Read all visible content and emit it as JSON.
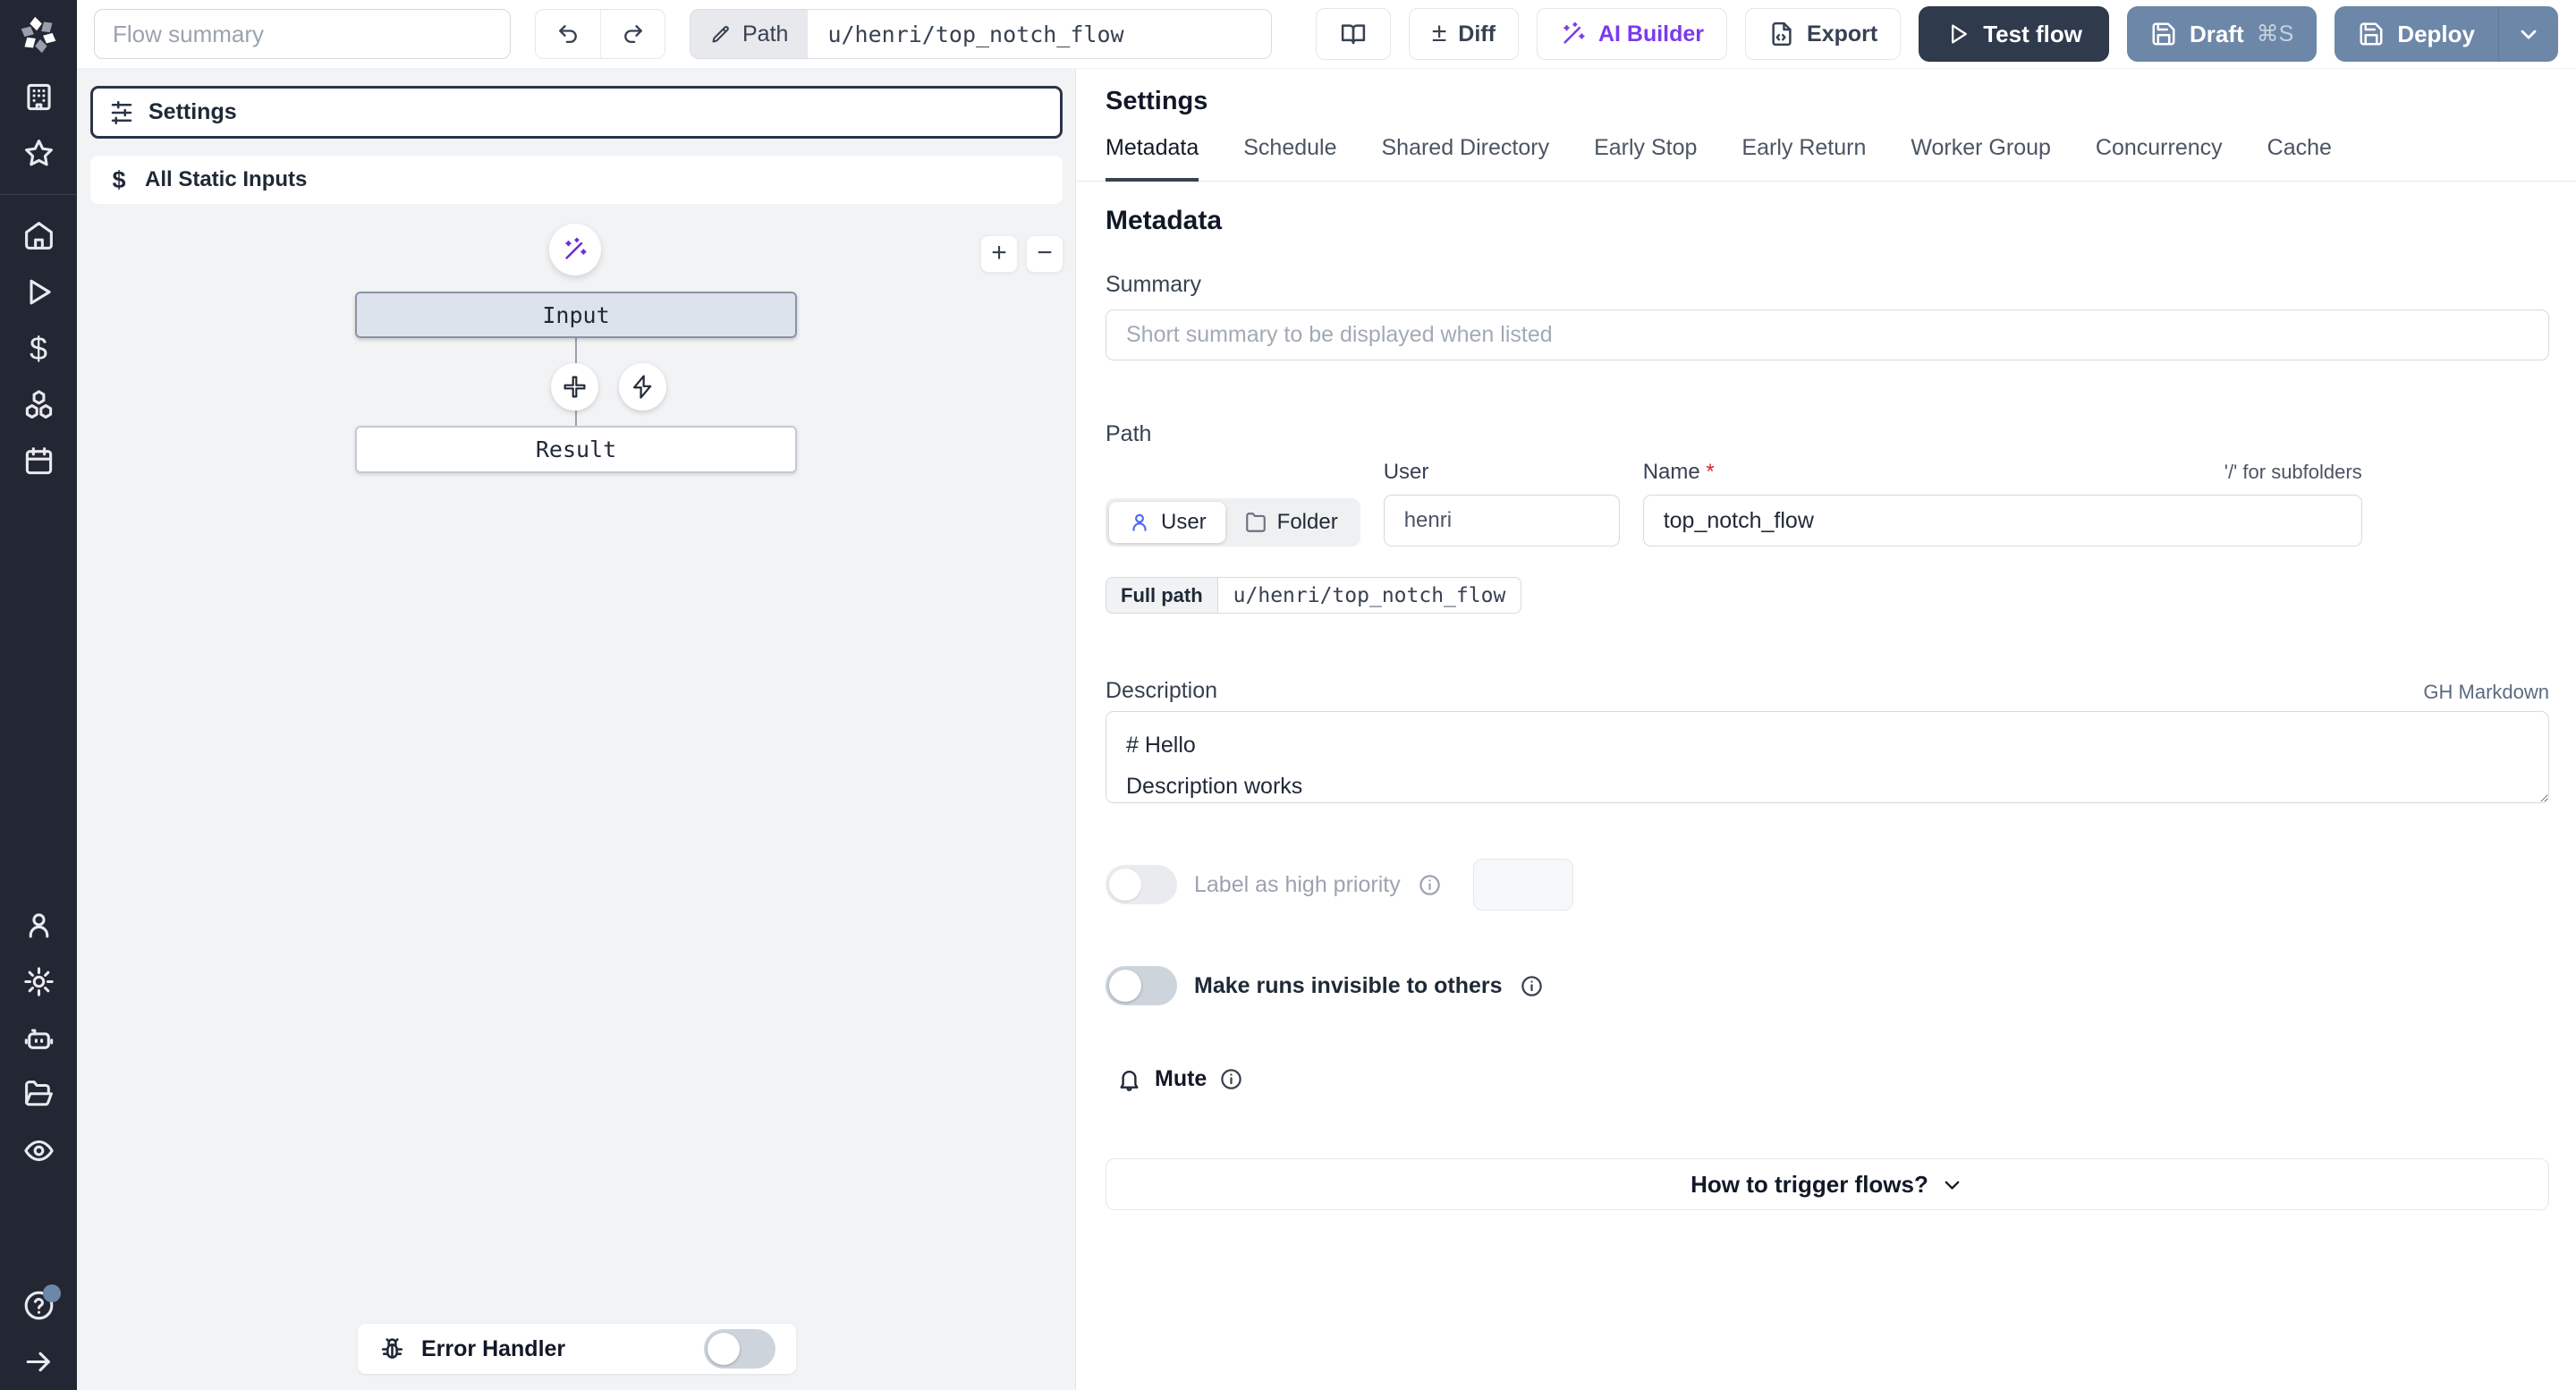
{
  "topbar": {
    "flow_summary_placeholder": "Flow summary",
    "path_button_label": "Path",
    "path_value": "u/henri/top_notch_flow",
    "diff_label": "Diff",
    "diff_glyph": "±",
    "ai_builder_label": "AI Builder",
    "export_label": "Export",
    "test_flow_label": "Test flow",
    "draft_label": "Draft",
    "draft_shortcut": "⌘S",
    "deploy_label": "Deploy"
  },
  "sidebar": {
    "icons": [
      "windmill-logo",
      "building",
      "star",
      "home",
      "play",
      "dollar-sign",
      "boxes",
      "calendar",
      "user",
      "settings-gear",
      "bot",
      "folder-open",
      "eye",
      "help-circle",
      "arrow-right"
    ],
    "dollar_glyph": "$"
  },
  "flow_panel": {
    "settings_button": "Settings",
    "static_inputs_button": "All Static Inputs",
    "static_inputs_glyph": "$",
    "input_node": "Input",
    "result_node": "Result",
    "zoom_in": "+",
    "zoom_out": "−",
    "error_handler_label": "Error Handler",
    "error_handler_enabled": false
  },
  "settings_panel": {
    "title": "Settings",
    "tabs": [
      "Metadata",
      "Schedule",
      "Shared Directory",
      "Early Stop",
      "Early Return",
      "Worker Group",
      "Concurrency",
      "Cache"
    ],
    "active_tab": "Metadata",
    "section_title": "Metadata",
    "summary": {
      "label": "Summary",
      "placeholder": "Short summary to be displayed when listed",
      "value": ""
    },
    "path": {
      "label": "Path",
      "owner_kind_options": [
        "User",
        "Folder"
      ],
      "owner_kind_selected": "User",
      "user_label": "User",
      "user_value": "henri",
      "name_label": "Name",
      "required_mark": "*",
      "subfolder_hint": "'/' for subfolders",
      "name_value": "top_notch_flow",
      "full_path_label": "Full path",
      "full_path_value": "u/henri/top_notch_flow"
    },
    "description": {
      "label": "Description",
      "hint": "GH Markdown",
      "value": "# Hello\nDescription works"
    },
    "high_priority": {
      "label": "Label as high priority",
      "enabled": false
    },
    "invisible_runs": {
      "label": "Make runs invisible to others",
      "enabled": false
    },
    "mute": {
      "label": "Mute",
      "enabled": false
    },
    "trigger": {
      "label": "How to trigger flows?"
    }
  },
  "colors": {
    "sidebar_bg": "#232733",
    "canvas_bg": "#f2f3f5",
    "test_flow_bg": "#2f3a4c",
    "deploy_blue": "#6d87a8",
    "ai_purple": "#7c3aed",
    "user_icon_blue": "#4b6bf5",
    "required_red": "#dc2626",
    "input_node_bg": "#dde3ec"
  }
}
